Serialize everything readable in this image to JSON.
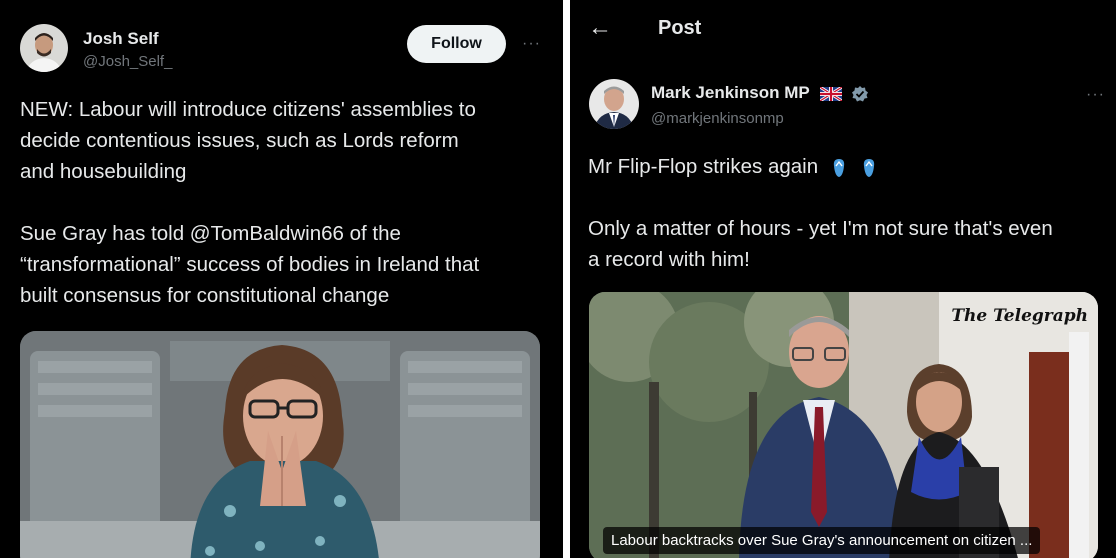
{
  "left_tweet": {
    "author_name": "Josh Self",
    "author_handle": "@Josh_Self_",
    "follow_label": "Follow",
    "more_label": "···",
    "paragraph1": [
      "NEW: Labour will introduce citizens' assemblies to",
      "decide contentious issues, such as Lords reform",
      "and housebuilding"
    ],
    "paragraph2": [
      "Sue Gray has told @TomBaldwin66 of the",
      "“transformational” success of bodies in Ireland that",
      "built consensus for constitutional change"
    ]
  },
  "right_tweet": {
    "header_title": "Post",
    "author_name": "Mark Jenkinson MP",
    "author_handle": "@markjenkinsonmp",
    "more_label": "···",
    "line1": "Mr Flip-Flop strikes again",
    "paragraph2": [
      "Only a matter of hours - yet I'm not sure that's even",
      "a record with him!"
    ],
    "media": {
      "masthead": "The Telegraph",
      "caption": "Labour backtracks over Sue Gray's announcement on citizen ..."
    }
  },
  "colors": {
    "background": "#000000",
    "text": "#e7e9ea",
    "muted": "#71767b",
    "follow_bg": "#eff3f4",
    "verified": "#829aab"
  },
  "icons": [
    "back-arrow-icon",
    "more-icon",
    "uk-flag-icon",
    "verified-badge-icon",
    "flip-flop-icon"
  ]
}
